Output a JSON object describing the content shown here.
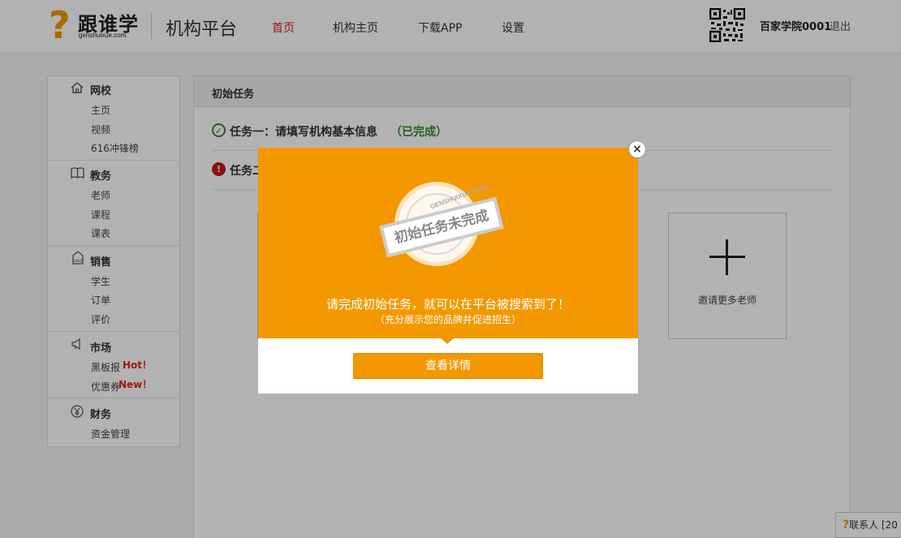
{
  "header": {
    "logo_mark": "?",
    "logo_name": "跟谁学",
    "logo_domain": "genshuixue.com",
    "platform": "机构平台",
    "nav": [
      {
        "label": "首页",
        "active": true
      },
      {
        "label": "机构主页",
        "active": false
      },
      {
        "label": "下载APP",
        "active": false
      },
      {
        "label": "设置",
        "active": false
      }
    ],
    "user": "百家学院0001",
    "logout": "退出",
    "qr_icon": "qr-code-icon"
  },
  "sidebar": {
    "sections": [
      {
        "title": "网校",
        "icon": "home-icon",
        "items": [
          "主页",
          "视频",
          "616冲锋榜"
        ]
      },
      {
        "title": "教务",
        "icon": "book-icon",
        "items": [
          "老师",
          "课程",
          "课表"
        ]
      },
      {
        "title": "销售",
        "icon": "sale-tag-icon",
        "items": [
          "学生",
          "订单",
          "评价"
        ]
      },
      {
        "title": "市场",
        "icon": "megaphone-icon",
        "items": [
          "黑板报",
          "优惠券"
        ],
        "tags": [
          "Hot！",
          "New！"
        ]
      },
      {
        "title": "财务",
        "icon": "yen-icon",
        "items": [
          "资金管理"
        ]
      }
    ]
  },
  "main": {
    "title": "初始任务",
    "task1": {
      "text": "任务一：请填写机构基本信息",
      "status": "（已完成）"
    },
    "task2": {
      "text": "任务二"
    },
    "invite_label": "邀请更多老师"
  },
  "modal": {
    "stamp_text": "初始任务未完成",
    "stamp_arc": "GENSHUIXUE.COM",
    "message": "请完成初始任务，就可以在平台被搜索到了！",
    "sub_message": "（充分展示您的品牌并促进招生）",
    "button": "查看详情",
    "close": "×"
  },
  "contact": {
    "label": "联系人 [20"
  },
  "colors": {
    "brand": "#f39800",
    "active_nav": "#e2231a",
    "success": "#2e8b2e",
    "error": "#c8161d"
  }
}
